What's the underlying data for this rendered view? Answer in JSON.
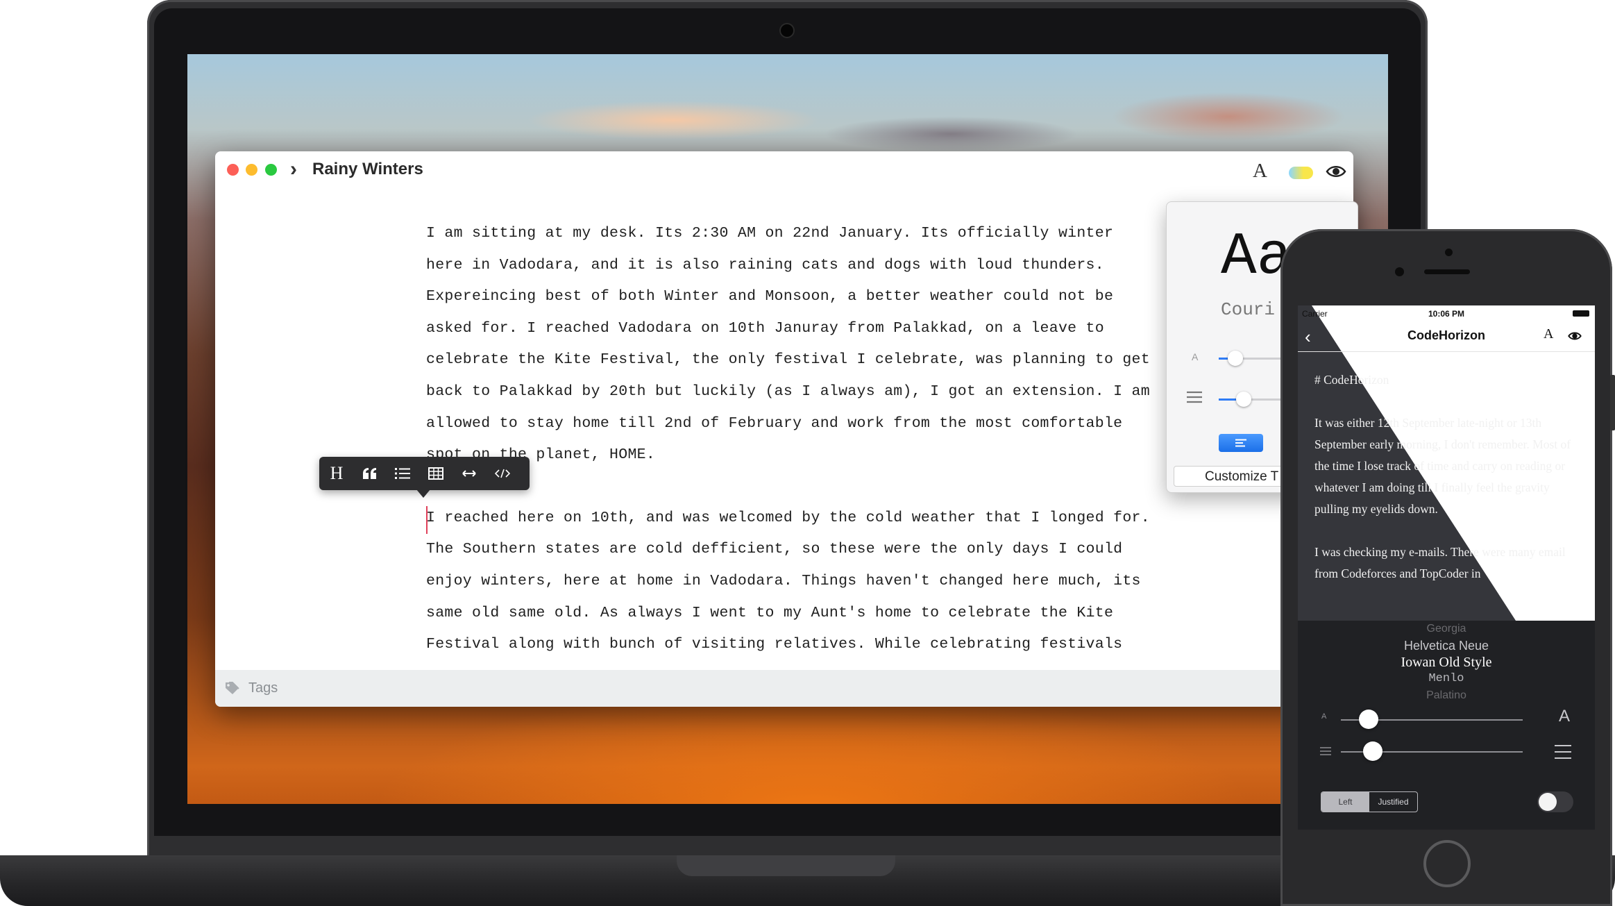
{
  "window": {
    "title": "Rainy Winters",
    "tags_label": "Tags"
  },
  "editor": {
    "paragraph1": [
      "I am sitting at my desk. Its 2:30 AM on 22nd January. Its officially winter",
      "here in Vadodara, and it is also raining cats and dogs with loud thunders.",
      "Expereincing best of both Winter and Monsoon, a better weather could not be",
      "asked for. I reached Vadodara on 10th Januray from Palakkad, on a leave to",
      "celebrate the Kite Festival, the only festival I celebrate, was planning to get",
      "back to Palakkad by 20th but luckily (as I always am), I got an extension. I am",
      "allowed to stay home till 2nd of February and work from the most comfortable",
      "spot on the planet, HOME."
    ],
    "paragraph2": [
      "I reached here on 10th, and was welcomed by the cold weather that I longed for.",
      "The Southern states are cold defficient, so these were the only days I could",
      "enjoy winters, here at home in Vadodara. Things haven't changed here much, its",
      "same old same old. As always I went to my Aunt's home to celebrate the Kite",
      "Festival along with bunch of visiting relatives. While celebrating festivals"
    ]
  },
  "format_toolbar": {
    "heading_label": "H",
    "items": [
      "heading-icon",
      "quote-icon",
      "list-icon",
      "table-icon",
      "rule-icon",
      "code-icon"
    ]
  },
  "popover": {
    "preview": "Aa",
    "font_name": "Couri",
    "size_small_label": "A",
    "customize_label": "Customize T",
    "font_size_level": 0.12,
    "line_height_level": 0.2
  },
  "phone": {
    "carrier": "Carrier",
    "time": "10:06 PM",
    "nav_title": "CodeHorizon",
    "heading": "# CodeHorizon",
    "paragraph1": "It was either 12th September late-night or 13th September early morning, I don't remember. Most of the time I lose track of time and carry on reading or whatever I am doing till I finally feel the gravity pulling my eyelids down.",
    "paragraph2": "I was checking my e-mails. There were many email from Codeforces and TopCoder in",
    "fonts": [
      "Georgia",
      "Helvetica Neue",
      "Iowan Old Style",
      "Menlo",
      "Palatino"
    ],
    "selected_font": "Iowan Old Style",
    "size_small_label": "A",
    "size_large_label": "A",
    "align_left_label": "Left",
    "align_justified_label": "Justified",
    "font_size_level": 0.25,
    "line_height_level": 0.27,
    "dark_mode_on": false
  },
  "colors": {
    "accent_blue": "#2f7cf6",
    "traffic_red": "#fc5f57",
    "traffic_yellow": "#fdbc2e",
    "traffic_green": "#2ac940",
    "cursor_pink": "#e0405a",
    "phone_dark": "#35363b"
  }
}
